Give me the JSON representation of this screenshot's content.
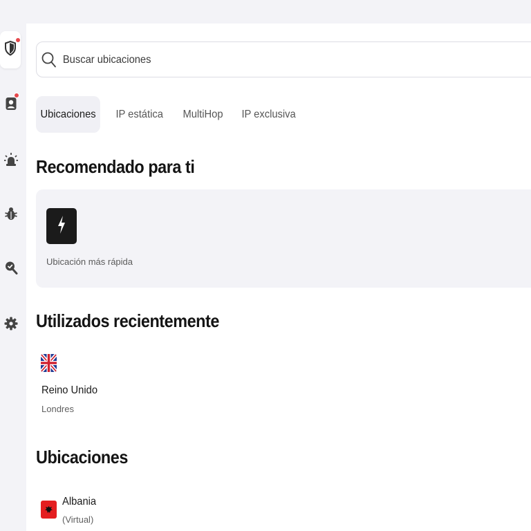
{
  "sidebar": {
    "items": [
      {
        "icon": "shield-icon",
        "badge": true,
        "active": true
      },
      {
        "icon": "user-icon",
        "badge": true,
        "active": false
      },
      {
        "icon": "alert-light-icon",
        "badge": false,
        "active": false
      },
      {
        "icon": "bug-icon",
        "badge": false,
        "active": false
      },
      {
        "icon": "search-check-icon",
        "badge": false,
        "active": false
      },
      {
        "icon": "gear-icon",
        "badge": false,
        "active": false
      }
    ]
  },
  "search": {
    "placeholder": "Buscar ubicaciones",
    "value": ""
  },
  "tabs": [
    {
      "label": "Ubicaciones",
      "active": true
    },
    {
      "label": "IP estática",
      "active": false
    },
    {
      "label": "MultiHop",
      "active": false
    },
    {
      "label": "IP exclusiva",
      "active": false
    }
  ],
  "recommended": {
    "title": "Recomendado para ti",
    "items": [
      {
        "icon": "bolt-icon",
        "label": "Ubicación más rápida"
      }
    ]
  },
  "recent": {
    "title": "Utilizados recientemente",
    "items": [
      {
        "flag": "uk-flag-icon",
        "country": "Reino Unido",
        "city": "Londres"
      }
    ]
  },
  "locations": {
    "title": "Ubicaciones",
    "items": [
      {
        "flag": "albania-flag-icon",
        "country": "Albania",
        "note": "(Virtual)"
      }
    ]
  },
  "colors": {
    "accent_badge": "#e5484d",
    "background": "#f3f3f7",
    "panel": "#ffffff",
    "bolt_box": "#1b1b1b"
  }
}
